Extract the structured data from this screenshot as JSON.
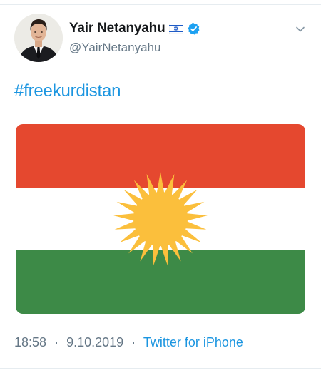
{
  "tweet": {
    "author": {
      "display_name": "Yair Netanyahu",
      "handle": "@YairNetanyahu",
      "verified": true,
      "name_emoji": "israel-flag-icon"
    },
    "text": "#freekurdistan",
    "media": {
      "type": "image",
      "subject": "flag-of-kurdistan",
      "colors": {
        "top": "#e5482f",
        "middle": "#ffffff",
        "bottom": "#3d8a47",
        "sun": "#fbbf3c"
      }
    },
    "meta": {
      "time": "18:58",
      "date": "9.10.2019",
      "separator": "·",
      "source": "Twitter for iPhone"
    }
  },
  "colors": {
    "link": "#1b95e0",
    "secondary_text": "#657786",
    "primary_text": "#14171a",
    "verified_badge": "#1da1f2"
  },
  "icons": {
    "more": "chevron-down-icon",
    "verified": "verified-badge-icon"
  }
}
